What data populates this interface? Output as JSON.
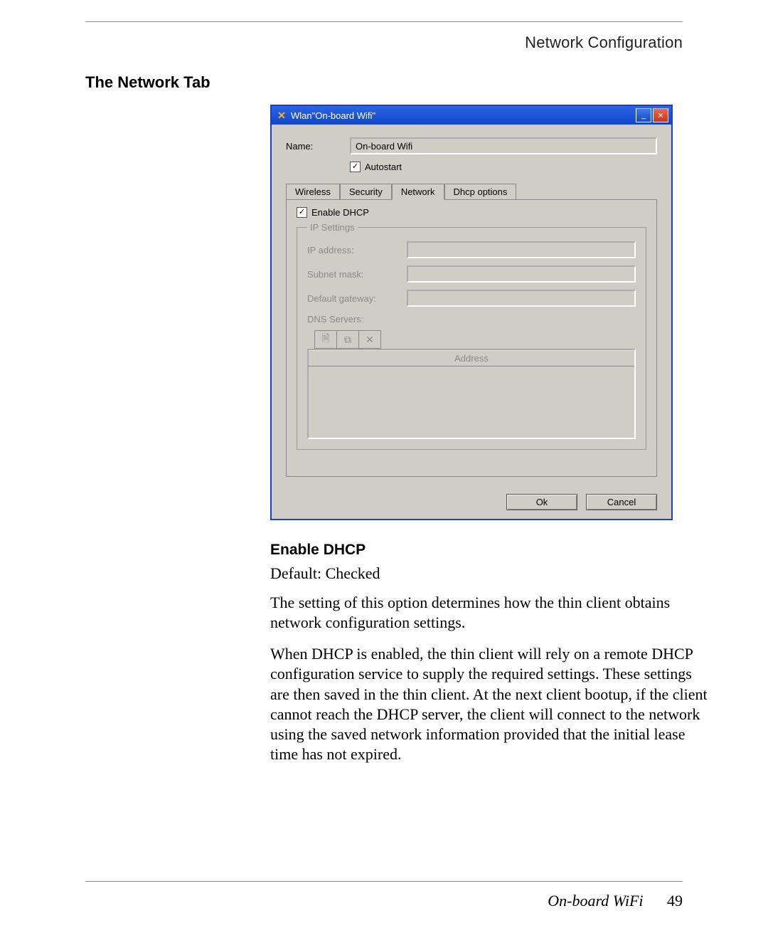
{
  "header": {
    "running_head": "Network Configuration"
  },
  "section": {
    "heading": "The Network Tab"
  },
  "window": {
    "title": "Wlan\"On-board Wifi\"",
    "name_label": "Name:",
    "name_value": "On-board Wifi",
    "autostart_label": "Autostart",
    "autostart_checked": "✓",
    "tabs": {
      "wireless": "Wireless",
      "security": "Security",
      "network": "Network",
      "dhcp": "Dhcp options"
    },
    "enable_dhcp_label": "Enable DHCP",
    "enable_dhcp_checked": "✓",
    "ip_settings_legend": "IP Settings",
    "ip_address_label": "IP address:",
    "subnet_mask_label": "Subnet mask:",
    "default_gateway_label": "Default gateway:",
    "dns_servers_label": "DNS Servers:",
    "dns_header": "Address",
    "ok": "Ok",
    "cancel": "Cancel"
  },
  "content": {
    "subhead": "Enable DHCP",
    "default_line": "Default: Checked",
    "para1": "The setting of this option determines how the thin client obtains network configuration settings.",
    "para2": "When DHCP is enabled, the thin client will rely on a remote DHCP configuration service to supply the required settings. These settings are then saved in the thin client. At the next client bootup, if the client cannot reach the DHCP server, the client will connect to the network using the saved network information provided that the initial lease time has not expired."
  },
  "footer": {
    "doc_title": "On-board WiFi",
    "page_no": "49"
  }
}
